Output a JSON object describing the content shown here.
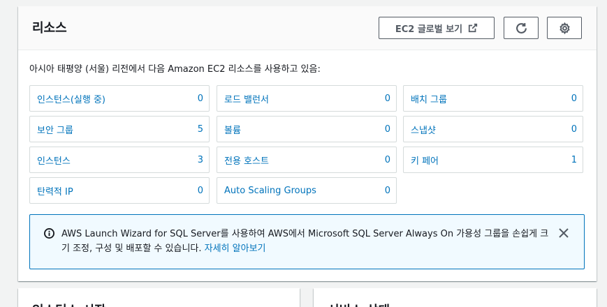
{
  "resources": {
    "title": "리소스",
    "global_view_label": "EC2 글로벌 보기",
    "description": "아시아 태평양 (서울) 리전에서 다음 Amazon EC2 리소스를 사용하고 있음:",
    "cards": [
      {
        "label": "인스턴스(실행 중)",
        "value": "0"
      },
      {
        "label": "로드 밸런서",
        "value": "0"
      },
      {
        "label": "배치 그룹",
        "value": "0"
      },
      {
        "label": "보안 그룹",
        "value": "5"
      },
      {
        "label": "볼륨",
        "value": "0"
      },
      {
        "label": "스냅샷",
        "value": "0"
      },
      {
        "label": "인스턴스",
        "value": "3"
      },
      {
        "label": "전용 호스트",
        "value": "0"
      },
      {
        "label": "키 페어",
        "value": "1"
      },
      {
        "label": "탄력적 IP",
        "value": "0"
      },
      {
        "label": "Auto Scaling Groups",
        "value": "0"
      }
    ],
    "info": {
      "text": "AWS Launch Wizard for SQL Server를 사용하여 AWS에서 Microsoft SQL Server Always On 가용성 그룹을 손쉽게 크기 조정, 구성 및 배포할 수 있습니다. ",
      "link": "자세히 알아보기"
    }
  },
  "bottom_panels": {
    "left_title": "인스턴스 시작",
    "right_title": "서비스 상태"
  },
  "colors": {
    "link": "#0073bb",
    "info_bg": "#f1faff",
    "border": "#d5dbdb"
  }
}
